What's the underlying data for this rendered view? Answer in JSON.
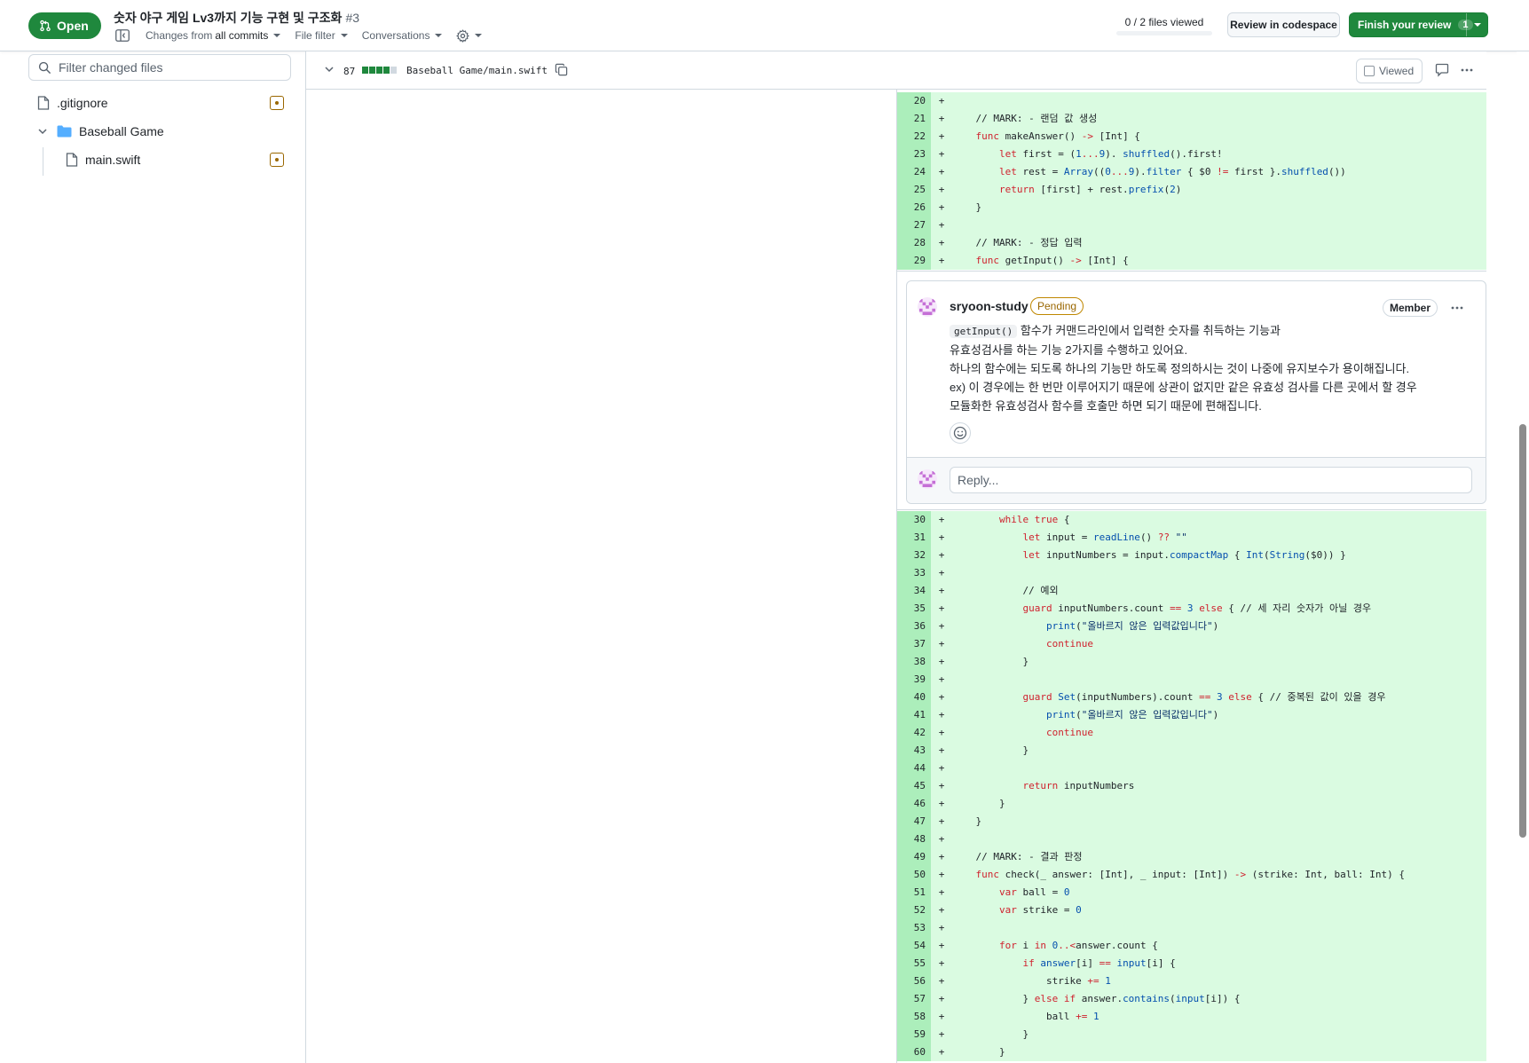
{
  "header": {
    "state": "Open",
    "title": "숫자 야구 게임 Lv3까지 기능 구현 및 구조화",
    "number": "#3",
    "changes_prefix": "Changes from",
    "changes_value": "all commits",
    "file_filter": "File filter",
    "conversations": "Conversations",
    "files_viewed": "0 / 2 files viewed",
    "files_viewed_progress": 0,
    "review_codespace": "Review in codespace",
    "finish_review": "Finish your review",
    "finish_review_count": "1"
  },
  "sidebar": {
    "filter_placeholder": "Filter changed files",
    "tree": [
      {
        "type": "file",
        "name": ".gitignore",
        "status": "modified"
      },
      {
        "type": "folder",
        "name": "Baseball Game",
        "expanded": true
      },
      {
        "type": "file",
        "name": "main.swift",
        "status": "modified"
      }
    ]
  },
  "file": {
    "changes": "87",
    "path": "Baseball Game/main.swift",
    "viewed_label": "Viewed",
    "viewed": false
  },
  "diff_top": [
    {
      "n": "20",
      "s": "+",
      "c": [
        [
          "",
          ""
        ]
      ]
    },
    {
      "n": "21",
      "s": "+",
      "c": [
        [
          "cm",
          "    // MARK: - 랜덤 값 생성"
        ]
      ]
    },
    {
      "n": "22",
      "s": "+",
      "c": [
        [
          "kw",
          "    func "
        ],
        [
          "",
          "makeAnswer() "
        ],
        [
          "kw",
          "->"
        ],
        [
          "",
          " [Int] {"
        ]
      ]
    },
    {
      "n": "23",
      "s": "+",
      "c": [
        [
          "kw",
          "        let "
        ],
        [
          "",
          "first = ("
        ],
        [
          "num-lit",
          "1"
        ],
        [
          "kw",
          "..."
        ],
        [
          "num-lit",
          "9"
        ],
        [
          "",
          "). "
        ],
        [
          "fn",
          "shuffled"
        ],
        [
          "",
          "().first!"
        ]
      ]
    },
    {
      "n": "24",
      "s": "+",
      "c": [
        [
          "kw",
          "        let "
        ],
        [
          "",
          "rest = "
        ],
        [
          "fn",
          "Array"
        ],
        [
          "",
          "(("
        ],
        [
          "num-lit",
          "0"
        ],
        [
          "kw",
          "..."
        ],
        [
          "num-lit",
          "9"
        ],
        [
          "",
          ")."
        ],
        [
          "fn",
          "filter"
        ],
        [
          "",
          " { $0 "
        ],
        [
          "kw",
          "!="
        ],
        [
          "",
          " first }."
        ],
        [
          "fn",
          "shuffled"
        ],
        [
          "",
          "())"
        ]
      ]
    },
    {
      "n": "25",
      "s": "+",
      "c": [
        [
          "kw",
          "        return "
        ],
        [
          "",
          "[first] + rest."
        ],
        [
          "fn",
          "prefix"
        ],
        [
          "",
          "("
        ],
        [
          "num-lit",
          "2"
        ],
        [
          "",
          ")"
        ]
      ]
    },
    {
      "n": "26",
      "s": "+",
      "c": [
        [
          "",
          "    }"
        ]
      ]
    },
    {
      "n": "27",
      "s": "+",
      "c": [
        [
          "",
          ""
        ]
      ]
    },
    {
      "n": "28",
      "s": "+",
      "c": [
        [
          "cm",
          "    // MARK: - 정답 입력"
        ]
      ]
    },
    {
      "n": "29",
      "s": "+",
      "c": [
        [
          "kw",
          "    func "
        ],
        [
          "",
          "getInput() "
        ],
        [
          "kw",
          "->"
        ],
        [
          "",
          " [Int] {"
        ]
      ]
    }
  ],
  "comment": {
    "author": "sryoon-study",
    "pending": "Pending",
    "role": "Member",
    "code_ref": "getInput()",
    "line1": " 함수가 커맨드라인에서 입력한 숫자를 취득하는 기능과",
    "line2": "유효성검사를 하는 기능 2가지를 수행하고 있어요.",
    "line3": "하나의 함수에는 되도록 하나의 기능만 하도록 정의하시는 것이 나중에 유지보수가 용이해집니다.",
    "line4": "ex) 이 경우에는 한 번만 이루어지기 때문에 상관이 없지만 같은 유효성 검사를 다른 곳에서 할 경우",
    "line5": "모듈화한 유효성검사 함수를 호출만 하면 되기 때문에 편해집니다.",
    "reply_placeholder": "Reply..."
  },
  "diff_bottom": [
    {
      "n": "30",
      "s": "+",
      "c": [
        [
          "kw",
          "        while "
        ],
        [
          "kw",
          "true"
        ],
        [
          "",
          " {"
        ]
      ]
    },
    {
      "n": "31",
      "s": "+",
      "c": [
        [
          "kw",
          "            let "
        ],
        [
          "",
          "input = "
        ],
        [
          "fn",
          "readLine"
        ],
        [
          "",
          "() "
        ],
        [
          "kw",
          "??"
        ],
        [
          "str",
          " \"\""
        ]
      ]
    },
    {
      "n": "32",
      "s": "+",
      "c": [
        [
          "kw",
          "            let "
        ],
        [
          "",
          "inputNumbers = input."
        ],
        [
          "fn",
          "compactMap"
        ],
        [
          "",
          " { "
        ],
        [
          "fn",
          "Int"
        ],
        [
          "",
          "("
        ],
        [
          "fn",
          "String"
        ],
        [
          "",
          "($0)) }"
        ]
      ]
    },
    {
      "n": "33",
      "s": "+",
      "c": [
        [
          "",
          ""
        ]
      ]
    },
    {
      "n": "34",
      "s": "+",
      "c": [
        [
          "cm",
          "            // 예외"
        ]
      ]
    },
    {
      "n": "35",
      "s": "+",
      "c": [
        [
          "kw",
          "            guard "
        ],
        [
          "",
          "inputNumbers.count "
        ],
        [
          "kw",
          "=="
        ],
        [
          "num-lit",
          " 3 "
        ],
        [
          "kw",
          "else"
        ],
        [
          "",
          " { // 세 자리 숫자가 아닐 경우"
        ]
      ]
    },
    {
      "n": "36",
      "s": "+",
      "c": [
        [
          "fn",
          "                print"
        ],
        [
          "",
          "("
        ],
        [
          "str",
          "\"올바르지 않은 입력값입니다\""
        ],
        [
          "",
          ")"
        ]
      ]
    },
    {
      "n": "37",
      "s": "+",
      "c": [
        [
          "kw",
          "                continue"
        ]
      ]
    },
    {
      "n": "38",
      "s": "+",
      "c": [
        [
          "",
          "            }"
        ]
      ]
    },
    {
      "n": "39",
      "s": "+",
      "c": [
        [
          "",
          ""
        ]
      ]
    },
    {
      "n": "40",
      "s": "+",
      "c": [
        [
          "kw",
          "            guard "
        ],
        [
          "fn",
          "Set"
        ],
        [
          "",
          "(inputNumbers).count "
        ],
        [
          "kw",
          "=="
        ],
        [
          "num-lit",
          " 3 "
        ],
        [
          "kw",
          "else"
        ],
        [
          "",
          " { // 중복된 값이 있을 경우"
        ]
      ]
    },
    {
      "n": "41",
      "s": "+",
      "c": [
        [
          "fn",
          "                print"
        ],
        [
          "",
          "("
        ],
        [
          "str",
          "\"올바르지 않은 입력값입니다\""
        ],
        [
          "",
          ")"
        ]
      ]
    },
    {
      "n": "42",
      "s": "+",
      "c": [
        [
          "kw",
          "                continue"
        ]
      ]
    },
    {
      "n": "43",
      "s": "+",
      "c": [
        [
          "",
          "            }"
        ]
      ]
    },
    {
      "n": "44",
      "s": "+",
      "c": [
        [
          "",
          ""
        ]
      ]
    },
    {
      "n": "45",
      "s": "+",
      "c": [
        [
          "kw",
          "            return "
        ],
        [
          "",
          "inputNumbers"
        ]
      ]
    },
    {
      "n": "46",
      "s": "+",
      "c": [
        [
          "",
          "        }"
        ]
      ]
    },
    {
      "n": "47",
      "s": "+",
      "c": [
        [
          "",
          "    }"
        ]
      ]
    },
    {
      "n": "48",
      "s": "+",
      "c": [
        [
          "",
          ""
        ]
      ]
    },
    {
      "n": "49",
      "s": "+",
      "c": [
        [
          "cm",
          "    // MARK: - 결과 판정"
        ]
      ]
    },
    {
      "n": "50",
      "s": "+",
      "c": [
        [
          "kw",
          "    func "
        ],
        [
          "",
          "check(_ answer: [Int], _ input: [Int]) "
        ],
        [
          "kw",
          "->"
        ],
        [
          "",
          " (strike: Int, ball: Int) {"
        ]
      ]
    },
    {
      "n": "51",
      "s": "+",
      "c": [
        [
          "kw",
          "        var "
        ],
        [
          "",
          "ball = "
        ],
        [
          "num-lit",
          "0"
        ]
      ]
    },
    {
      "n": "52",
      "s": "+",
      "c": [
        [
          "kw",
          "        var "
        ],
        [
          "",
          "strike = "
        ],
        [
          "num-lit",
          "0"
        ]
      ]
    },
    {
      "n": "53",
      "s": "+",
      "c": [
        [
          "",
          ""
        ]
      ]
    },
    {
      "n": "54",
      "s": "+",
      "c": [
        [
          "kw",
          "        for "
        ],
        [
          "",
          "i "
        ],
        [
          "kw",
          "in "
        ],
        [
          "num-lit",
          "0"
        ],
        [
          "kw",
          "..<"
        ],
        [
          "",
          "answer.count {"
        ]
      ]
    },
    {
      "n": "55",
      "s": "+",
      "c": [
        [
          "kw",
          "            if "
        ],
        [
          "fn",
          "answer"
        ],
        [
          "",
          "[i] "
        ],
        [
          "kw",
          "=="
        ],
        [
          "",
          " "
        ],
        [
          "fn",
          "input"
        ],
        [
          "",
          "[i] {"
        ]
      ]
    },
    {
      "n": "56",
      "s": "+",
      "c": [
        [
          "",
          "                strike "
        ],
        [
          "kw",
          "+="
        ],
        [
          "num-lit",
          " 1"
        ]
      ]
    },
    {
      "n": "57",
      "s": "+",
      "c": [
        [
          "",
          "            } "
        ],
        [
          "kw",
          "else if "
        ],
        [
          "",
          "answer."
        ],
        [
          "fn",
          "contains"
        ],
        [
          "",
          "("
        ],
        [
          "fn",
          "input"
        ],
        [
          "",
          "[i]) {"
        ]
      ]
    },
    {
      "n": "58",
      "s": "+",
      "c": [
        [
          "",
          "                ball "
        ],
        [
          "kw",
          "+="
        ],
        [
          "num-lit",
          " 1"
        ]
      ]
    },
    {
      "n": "59",
      "s": "+",
      "c": [
        [
          "",
          "            }"
        ]
      ]
    },
    {
      "n": "60",
      "s": "+",
      "c": [
        [
          "",
          "        }"
        ]
      ]
    }
  ]
}
